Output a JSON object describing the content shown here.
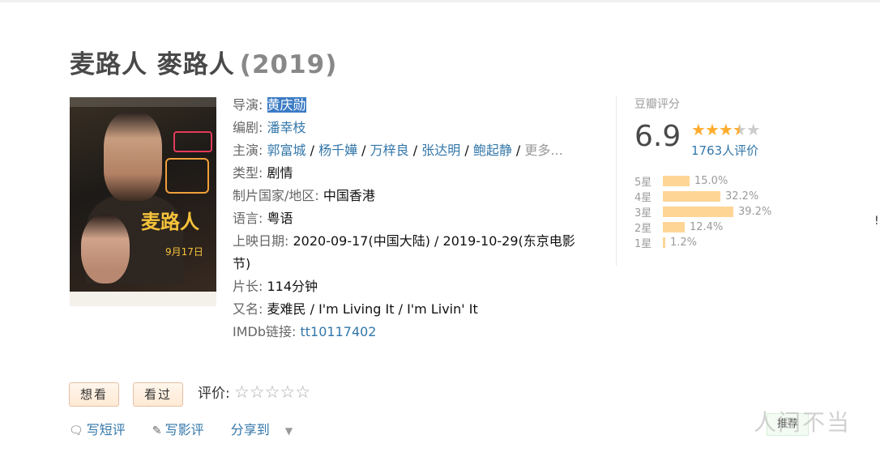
{
  "title": {
    "cn": "麦路人 麥路人",
    "year": "(2019)"
  },
  "info": {
    "director_label": "导演:",
    "director": "黄庆勋",
    "writer_label": "编剧:",
    "writer": "潘幸枝",
    "cast_label": "主演:",
    "cast": [
      "郭富城",
      "杨千嬅",
      "万梓良",
      "张达明",
      "鲍起静"
    ],
    "cast_sep": " / ",
    "cast_more": "更多...",
    "genre_label": "类型:",
    "genre": "剧情",
    "country_label": "制片国家/地区:",
    "country": "中国香港",
    "language_label": "语言:",
    "language": "粤语",
    "release_label": "上映日期:",
    "release": "2020-09-17(中国大陆) / 2019-10-29(东京电影节)",
    "runtime_label": "片长:",
    "runtime": "114分钟",
    "aka_label": "又名:",
    "aka": "麦难民 / I'm Living It / I'm Livin' It",
    "imdb_label": "IMDb链接:",
    "imdb": "tt10117402"
  },
  "rating": {
    "label": "豆瓣评分",
    "score": "6.9",
    "stars_filled": 3.5,
    "count": "1763人评价",
    "bars": [
      {
        "star": "5星",
        "pct": "15.0%",
        "value": 15.0
      },
      {
        "star": "4星",
        "pct": "32.2%",
        "value": 32.2
      },
      {
        "star": "3星",
        "pct": "39.2%",
        "value": 39.2
      },
      {
        "star": "2星",
        "pct": "12.4%",
        "value": 12.4
      },
      {
        "star": "1星",
        "pct": "1.2%",
        "value": 1.2
      }
    ]
  },
  "actions": {
    "want": "想看",
    "seen": "看过",
    "rate_label": "评价:",
    "rate_stars": "☆☆☆☆☆"
  },
  "links": {
    "short_review": "写短评",
    "review": "写影评",
    "share": "分享到"
  },
  "recommend": "推荐",
  "watermark": "人间不当",
  "edge_char": "!",
  "poster": {
    "title": "麦路人",
    "date": "9月17日"
  },
  "colors": {
    "link": "#3377aa",
    "star": "#ffac2d",
    "bar": "#ffd596"
  }
}
